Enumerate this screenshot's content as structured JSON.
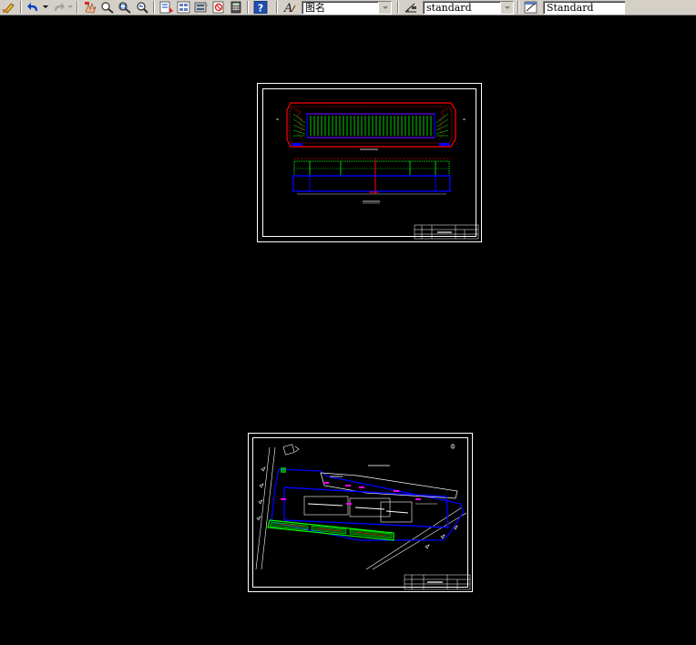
{
  "toolbar": {
    "buttons": [
      {
        "name": "match-properties-icon"
      },
      {
        "name": "undo-icon"
      },
      {
        "name": "undo-dropdown-icon"
      },
      {
        "name": "redo-icon"
      },
      {
        "name": "redo-dropdown-icon"
      },
      {
        "name": "pan-icon"
      },
      {
        "name": "zoom-realtime-icon"
      },
      {
        "name": "zoom-window-icon"
      },
      {
        "name": "zoom-previous-icon"
      },
      {
        "name": "properties-icon"
      },
      {
        "name": "design-center-icon"
      },
      {
        "name": "tool-palettes-icon"
      },
      {
        "name": "sheet-set-icon"
      },
      {
        "name": "markup-icon"
      },
      {
        "name": "calculator-icon"
      },
      {
        "name": "help-icon"
      }
    ],
    "text_style_combo": {
      "value": "图名"
    },
    "dim_style_combo": {
      "value": "standard"
    },
    "table_style_combo": {
      "value": "Standard"
    }
  },
  "colors": {
    "canvas": "#000000",
    "frame": "#ffffff",
    "red": "#ff0000",
    "green": "#00ff00",
    "blue": "#0000ff",
    "magenta": "#ff00ff"
  }
}
